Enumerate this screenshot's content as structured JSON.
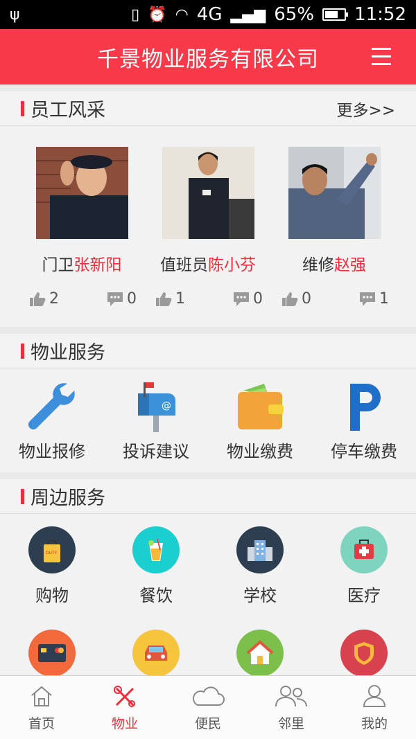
{
  "status": {
    "network": "4G",
    "battery": "65%",
    "time": "11:52"
  },
  "header": {
    "title": "千景物业服务有限公司",
    "menu_icon": "hamburger-menu-icon"
  },
  "staff": {
    "title": "员工风采",
    "more": "更多>>",
    "items": [
      {
        "role": "门卫",
        "name": "张新阳",
        "likes": "2",
        "comments": "0"
      },
      {
        "role": "值班员",
        "name": "陈小芬",
        "likes": "1",
        "comments": "0"
      },
      {
        "role": "维修",
        "name": "赵强",
        "likes": "0",
        "comments": "1"
      }
    ]
  },
  "property": {
    "title": "物业服务",
    "items": [
      {
        "label": "物业报修",
        "icon": "wrench-icon"
      },
      {
        "label": "投诉建议",
        "icon": "mailbox-icon"
      },
      {
        "label": "物业缴费",
        "icon": "wallet-icon"
      },
      {
        "label": "停车缴费",
        "icon": "parking-icon"
      }
    ]
  },
  "nearby": {
    "title": "周边服务",
    "items": [
      {
        "label": "购物",
        "icon": "shopping-bag-icon",
        "color": "#2c3e50"
      },
      {
        "label": "餐饮",
        "icon": "drink-icon",
        "color": "#1bcfd0"
      },
      {
        "label": "学校",
        "icon": "school-building-icon",
        "color": "#2c3e50"
      },
      {
        "label": "医疗",
        "icon": "first-aid-icon",
        "color": "#7fd4c0"
      }
    ],
    "row2": [
      {
        "icon": "card-icon",
        "color": "#f26a3c"
      },
      {
        "icon": "car-icon",
        "color": "#f7c53d"
      },
      {
        "icon": "house-icon",
        "color": "#7cbf4a"
      },
      {
        "icon": "shield-icon",
        "color": "#d8414e"
      }
    ]
  },
  "tabs": [
    {
      "label": "首页",
      "icon": "home-icon"
    },
    {
      "label": "物业",
      "icon": "tools-icon",
      "active": true
    },
    {
      "label": "便民",
      "icon": "cloud-icon"
    },
    {
      "label": "邻里",
      "icon": "neighbors-icon"
    },
    {
      "label": "我的",
      "icon": "profile-icon"
    }
  ],
  "colors": {
    "brand": "#f7394a",
    "accent_text": "#f02c3c"
  }
}
